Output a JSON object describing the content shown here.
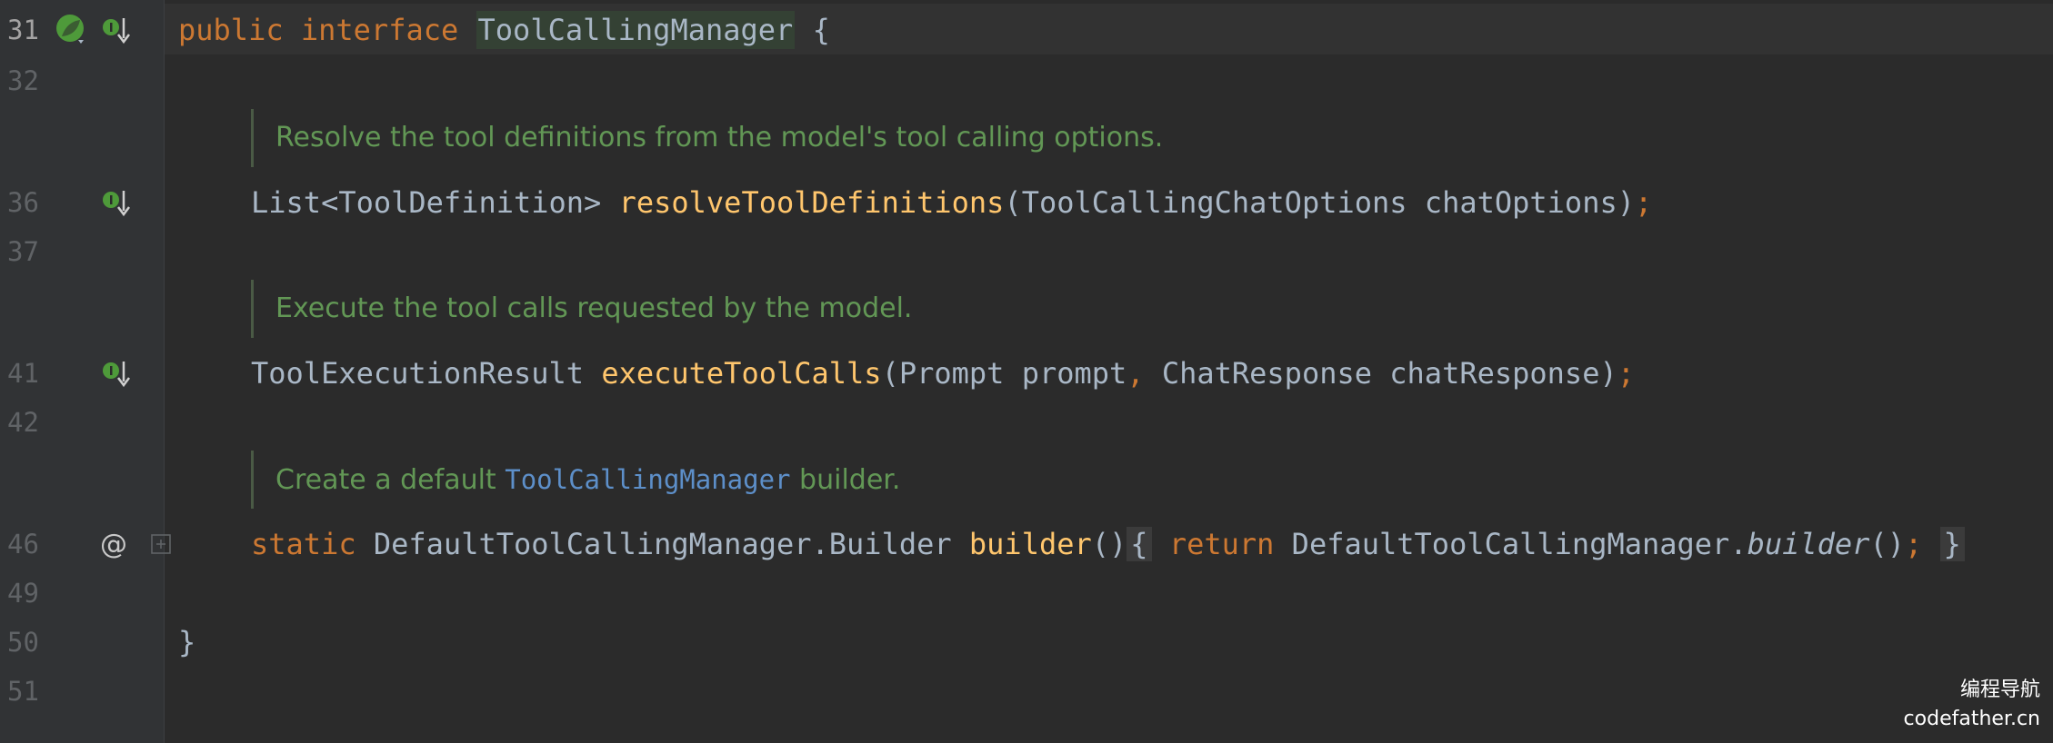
{
  "gutter": {
    "line_numbers": [
      "31",
      "32",
      "36",
      "37",
      "41",
      "42",
      "46",
      "49",
      "50",
      "51"
    ]
  },
  "code": {
    "line31": {
      "kw_public": "public",
      "kw_interface": "interface",
      "class_name": "ToolCallingManager",
      "brace": "{"
    },
    "doc1": "Resolve the tool definitions from the model's tool calling options.",
    "line36": {
      "return_type": "List<ToolDefinition>",
      "method": "resolveToolDefinitions",
      "params": "(ToolCallingChatOptions chatOptions)",
      "semi": ";"
    },
    "doc2": "Execute the tool calls requested by the model.",
    "line41": {
      "return_type": "ToolExecutionResult",
      "method": "executeToolCalls",
      "p1": "(Prompt prompt",
      "comma": ",",
      "p2": " ChatResponse chatResponse)",
      "semi": ";"
    },
    "doc3": {
      "before": "Create a default ",
      "link": "ToolCallingManager",
      "after": " builder."
    },
    "line46": {
      "kw_static": "static",
      "return_type": "DefaultToolCallingManager.Builder",
      "method": "builder",
      "parens": "()",
      "open_brace": "{",
      "kw_return": "return",
      "target": "DefaultToolCallingManager.",
      "call": "builder",
      "call_parens": "()",
      "semi": ";",
      "close_brace": "}"
    },
    "line50": {
      "brace": "}"
    }
  },
  "watermark": {
    "line1": "编程导航",
    "line2": "codefather.cn"
  },
  "colors": {
    "background": "#2b2b2b",
    "keyword": "#cc7832",
    "method": "#ffc66d",
    "doc": "#629755",
    "link": "#5d8fc9",
    "implement_icon": "#4e9a3a"
  }
}
